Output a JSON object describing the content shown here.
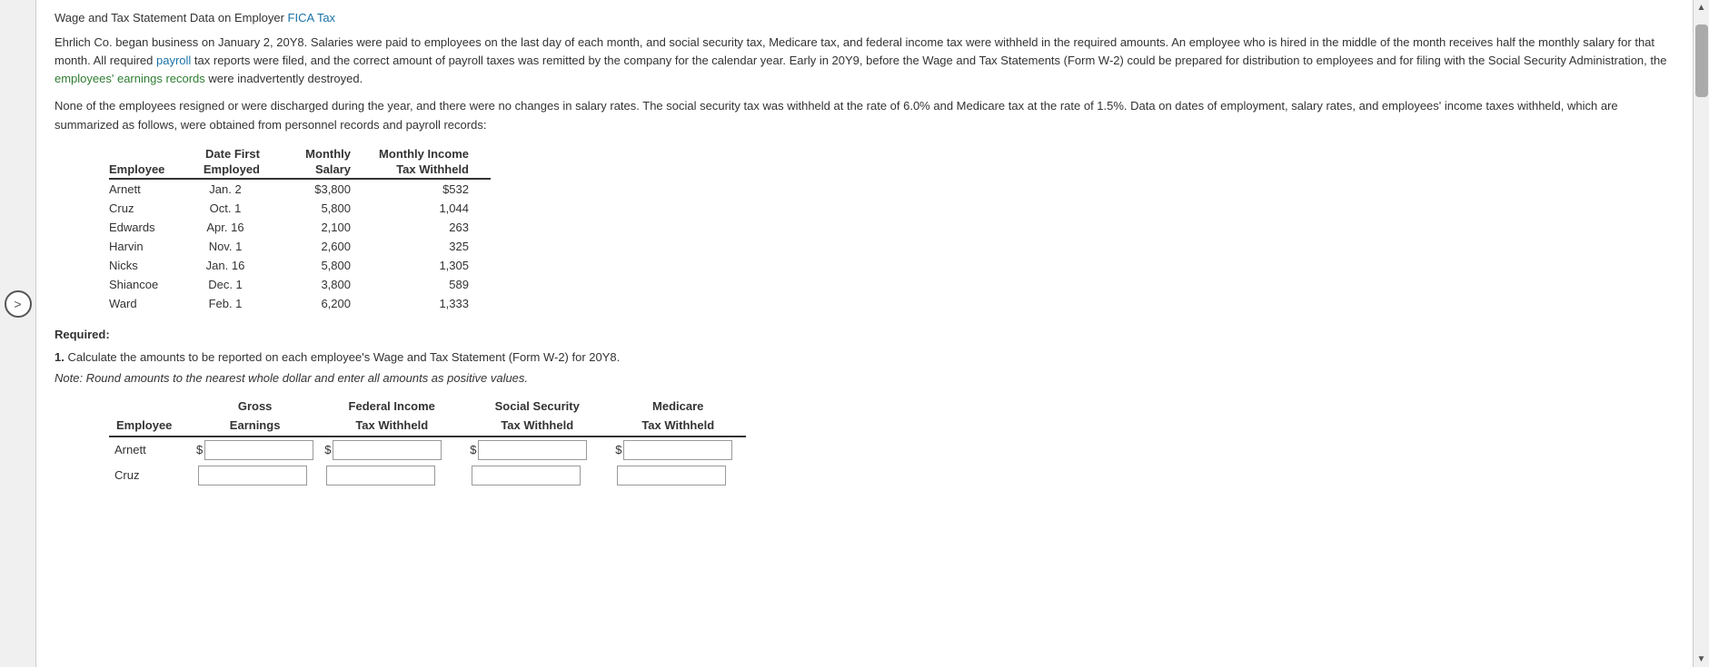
{
  "title": {
    "text": "Wage and Tax Statement Data on Employer",
    "link1_text": "FICA Tax",
    "link1_url": "#"
  },
  "paragraph1": "Ehrlich Co. began business on January 2, 20Y8. Salaries were paid to employees on the last day of each month, and social security tax, Medicare tax, and federal income tax were withheld in the required amounts. An employee who is hired in the middle of the month receives half the monthly salary for that month. All required",
  "paragraph1_link_text": "payroll",
  "paragraph1_mid": "tax reports were filed, and the correct amount of payroll taxes was remitted by the company for the calendar year. Early in 20Y9, before the Wage and Tax Statements (Form W-2) could be prepared for distribution to employees and for filing with the Social Security Administration, the",
  "paragraph1_link2_text": "employees' earnings records",
  "paragraph1_end": "were inadvertently destroyed.",
  "paragraph2": "None of the employees resigned or were discharged during the year, and there were no changes in salary rates. The social security tax was withheld at the rate of 6.0% and Medicare tax at the rate of 1.5%. Data on dates of employment, salary rates, and employees' income taxes withheld, which are summarized as follows, were obtained from personnel records and payroll records:",
  "employee_table": {
    "headers": [
      [
        "Employee",
        "Date First\nEmployed",
        "Monthly\nSalary",
        "Monthly Income\nTax Withheld"
      ],
      [
        "",
        "Date First",
        "Monthly",
        "Monthly Income"
      ],
      [
        "Employee",
        "Employed",
        "Salary",
        "Tax Withheld"
      ]
    ],
    "col1_header": "Employee",
    "col2_header_line1": "Date First",
    "col2_header_line2": "Employed",
    "col3_header_line1": "Monthly",
    "col3_header_line2": "Salary",
    "col4_header_line1": "Monthly Income",
    "col4_header_line2": "Tax Withheld",
    "rows": [
      {
        "employee": "Arnett",
        "date": "Jan. 2",
        "salary": "$3,800",
        "tax": "$532"
      },
      {
        "employee": "Cruz",
        "date": "Oct. 1",
        "salary": "5,800",
        "tax": "1,044"
      },
      {
        "employee": "Edwards",
        "date": "Apr. 16",
        "salary": "2,100",
        "tax": "263"
      },
      {
        "employee": "Harvin",
        "date": "Nov. 1",
        "salary": "2,600",
        "tax": "325"
      },
      {
        "employee": "Nicks",
        "date": "Jan. 16",
        "salary": "5,800",
        "tax": "1,305"
      },
      {
        "employee": "Shiancoe",
        "date": "Dec. 1",
        "salary": "3,800",
        "tax": "589"
      },
      {
        "employee": "Ward",
        "date": "Feb. 1",
        "salary": "6,200",
        "tax": "1,333"
      }
    ]
  },
  "required_label": "Required:",
  "question": {
    "number": "1.",
    "text": "Calculate the amounts to be reported on each employee's Wage and Tax Statement (Form W-2) for 20Y8."
  },
  "note": "Note: Round amounts to the nearest whole dollar and enter all amounts as positive values.",
  "input_table": {
    "col1_header": "Employee",
    "col2_header_line1": "Gross",
    "col2_header_line2": "Earnings",
    "col3_header_line1": "Federal Income",
    "col3_header_line2": "Tax Withheld",
    "col4_header_line1": "Social Security",
    "col4_header_line2": "Tax Withheld",
    "col5_header_line1": "Medicare",
    "col5_header_line2": "Tax Withheld",
    "input_rows": [
      {
        "employee": "Arnett",
        "visible": true
      },
      {
        "employee": "Cruz",
        "visible": true
      }
    ]
  },
  "nav": {
    "arrow": ">"
  }
}
